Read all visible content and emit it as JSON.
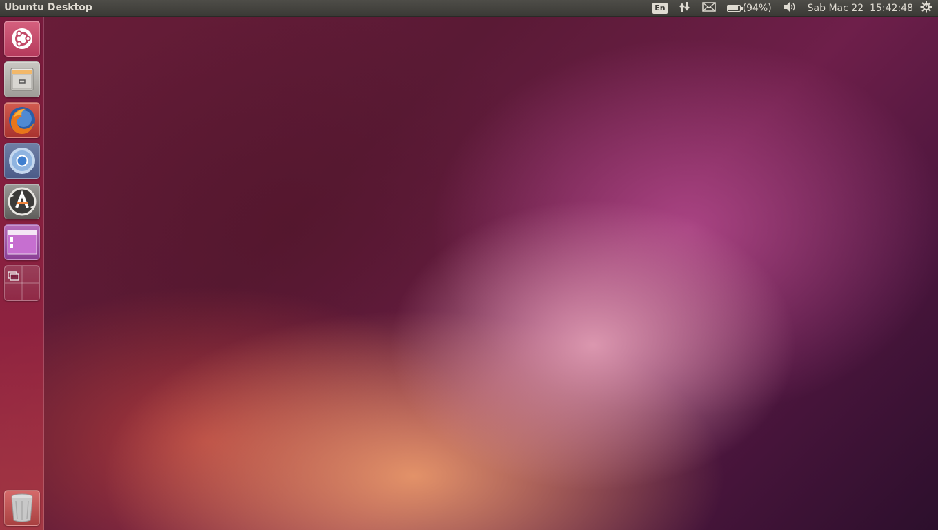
{
  "panel": {
    "window_title": "Ubuntu Desktop",
    "keyboard_layout": "En",
    "battery_percent_label": "(94%)",
    "battery_level": 0.94,
    "date": "Sab Mac 22",
    "time": "15:42:48",
    "icons": [
      "network-icon",
      "mail-icon",
      "battery-icon",
      "volume-icon",
      "power-gear-icon"
    ]
  },
  "launcher": {
    "items": [
      {
        "name": "dash-home",
        "icon": "ubuntu-logo-icon"
      },
      {
        "name": "files",
        "icon": "file-cabinet-icon"
      },
      {
        "name": "firefox",
        "icon": "firefox-icon"
      },
      {
        "name": "chromium",
        "icon": "chromium-icon"
      },
      {
        "name": "software-updater",
        "icon": "software-updater-icon"
      },
      {
        "name": "app-window",
        "icon": "window-app-icon"
      },
      {
        "name": "workspace-switcher",
        "icon": "workspace-switcher-icon"
      },
      {
        "name": "trash",
        "icon": "trash-icon"
      }
    ]
  },
  "colors": {
    "panel_bg": "#3c3b37",
    "panel_text": "#dfdbd2",
    "wallpaper_primary": "#6a1d38",
    "wallpaper_accent": "#e59bb6"
  }
}
